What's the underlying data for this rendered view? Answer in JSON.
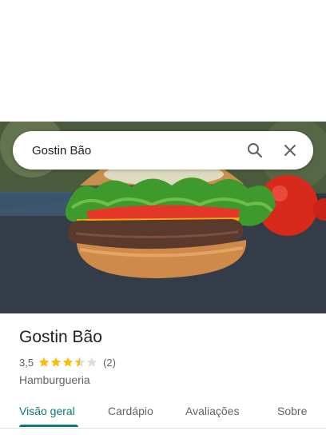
{
  "search": {
    "query": "Gostin Bão"
  },
  "place": {
    "name": "Gostin Bão",
    "rating": "3,5",
    "rating_value": 3.5,
    "rating_max": 5,
    "review_count": "(2)",
    "category": "Hamburgueria"
  },
  "tabs": [
    {
      "label": "Visão geral",
      "active": true
    },
    {
      "label": "Cardápio",
      "active": false
    },
    {
      "label": "Avaliações",
      "active": false
    },
    {
      "label": "Sobre",
      "active": false
    }
  ],
  "colors": {
    "star": "#fbbc04",
    "star_empty": "#dadce0",
    "accent": "#0b7a75"
  },
  "icons": {
    "search": "search-icon",
    "close": "close-icon"
  }
}
